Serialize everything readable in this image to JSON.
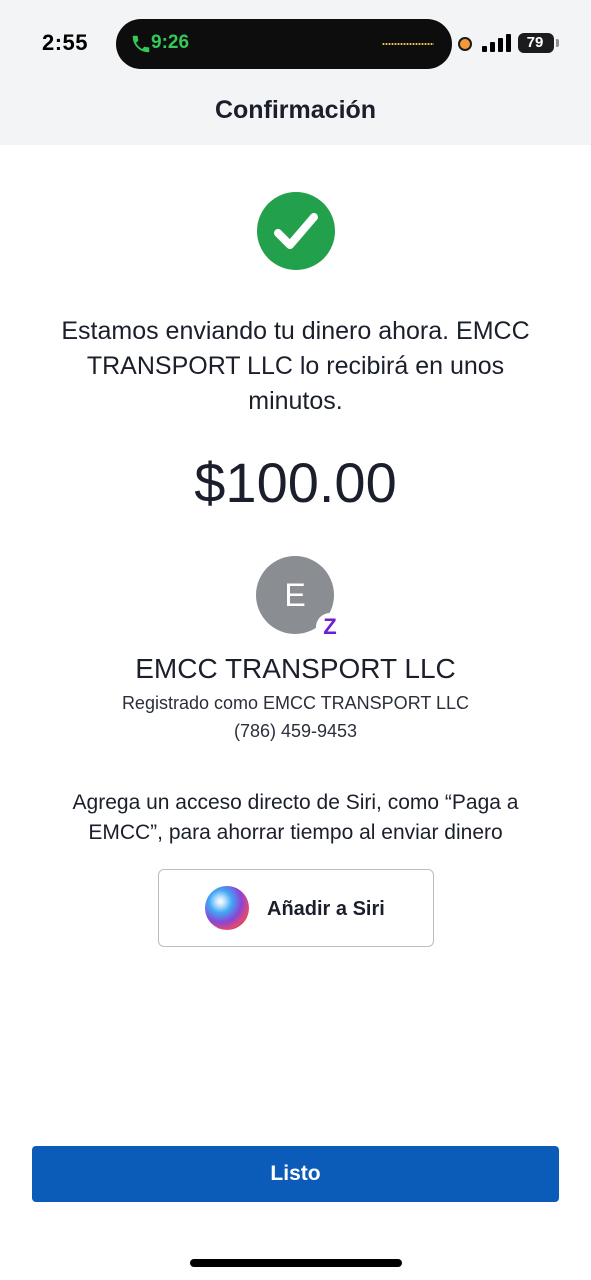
{
  "status_bar": {
    "time": "2:55",
    "call_time": "9:26",
    "battery": "79",
    "icons": [
      "phone-icon",
      "recording-dot-icon",
      "signal-icon",
      "battery-icon"
    ]
  },
  "header": {
    "title": "Confirmación"
  },
  "confirmation": {
    "message": "Estamos enviando tu dinero ahora. EMCC TRANSPORT LLC lo recibirá en unos minutos.",
    "amount": "$100.00"
  },
  "recipient": {
    "initial": "E",
    "badge": "Z",
    "name": "EMCC TRANSPORT LLC",
    "registered_as": "Registrado como EMCC TRANSPORT LLC",
    "phone": "(786) 459-9453"
  },
  "siri": {
    "prompt": "Agrega un acceso directo de Siri, como “Paga a EMCC”, para ahorrar tiempo al enviar dinero",
    "button_label": "Añadir a Siri"
  },
  "footer": {
    "done_label": "Listo"
  },
  "colors": {
    "success": "#22a04b",
    "primary_button": "#0b5cb8",
    "zelle_purple": "#6d1ed4",
    "call_green": "#34c759",
    "header_bg": "#f3f4f6"
  }
}
